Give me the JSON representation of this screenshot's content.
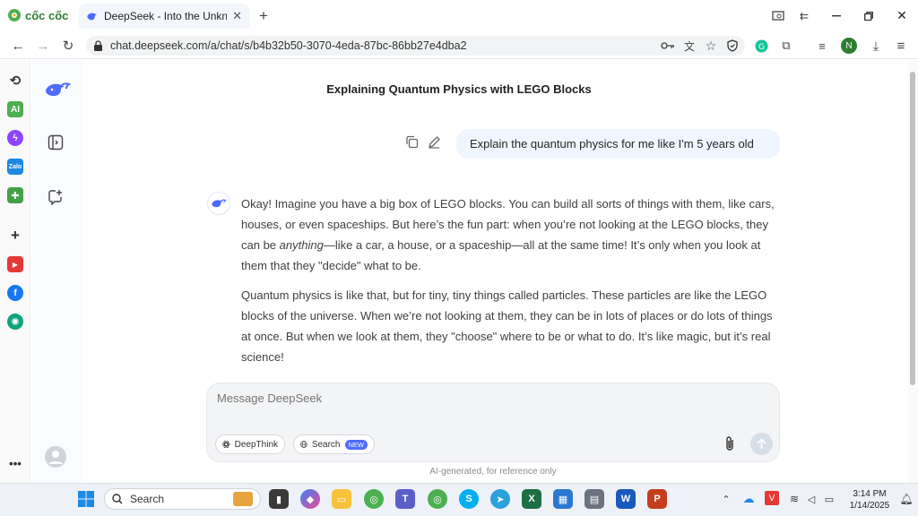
{
  "browser": {
    "brand": "cốc cốc",
    "tab_title": "DeepSeek - Into the Unknown",
    "url": "chat.deepseek.com/a/chat/s/b4b32b50-3070-4eda-87bc-86bb27e4dba2",
    "profile_initial": "N"
  },
  "chat": {
    "title": "Explaining Quantum Physics with LEGO Blocks",
    "user_message": "Explain the quantum physics for me like I'm 5 years old",
    "answer_p1_a": "Okay! Imagine you have a big box of LEGO blocks. You can build all sorts of things with them, like cars, houses, or even spaceships. But here’s the fun part: when you’re not looking at the LEGO blocks, they can be ",
    "answer_p1_em": "anything",
    "answer_p1_b": "—like a car, a house, or a spaceship—all at the same time! It’s only when you look at them that they \"decide\" what to be.",
    "answer_p2": "Quantum physics is like that, but for tiny, tiny things called particles. These particles are like the LEGO blocks of the universe. When we’re not looking at them, they can be in lots of places or do lots of things at once. But when we look at them, they \"choose\" where to be or what to do. It’s like magic, but it’s real science!",
    "input_placeholder": "Message DeepSeek",
    "deepthink_label": "DeepThink",
    "search_label": "Search",
    "new_badge": "NEW",
    "disclaimer": "AI-generated, for reference only"
  },
  "taskbar": {
    "search_label": "Search",
    "time": "3:14 PM",
    "date": "1/14/2025"
  },
  "colors": {
    "accent": "#4d6bfe",
    "user_bubble": "#eff6ff"
  }
}
